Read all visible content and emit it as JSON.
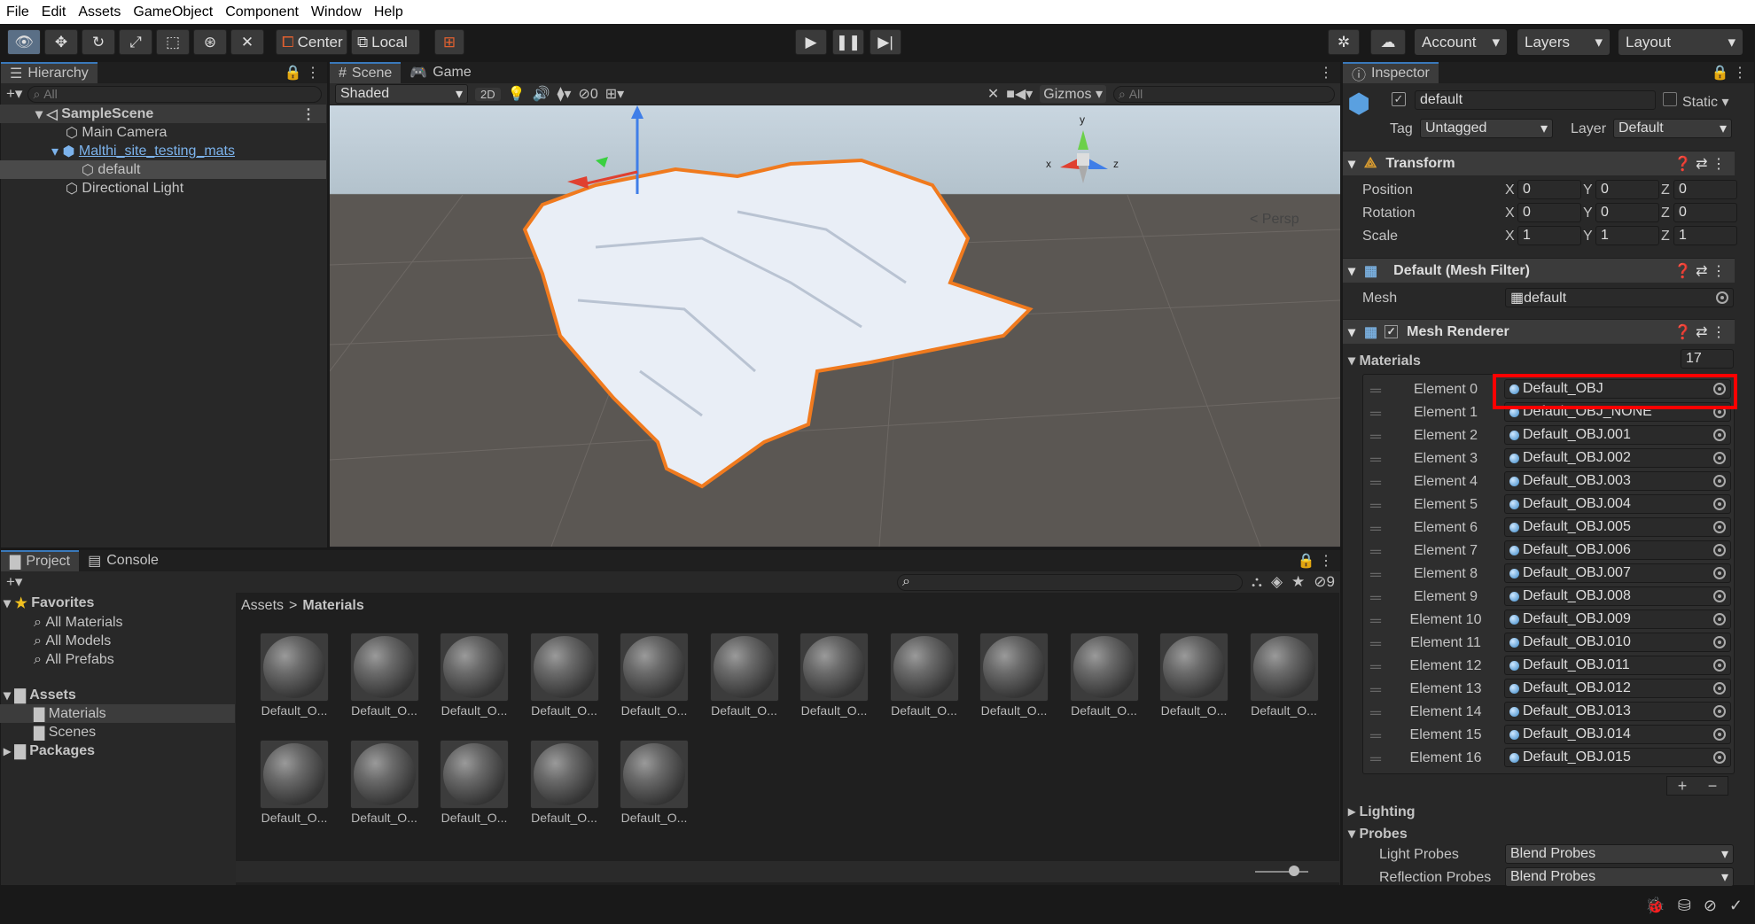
{
  "menu": [
    "File",
    "Edit",
    "Assets",
    "GameObject",
    "Component",
    "Window",
    "Help"
  ],
  "toolbar": {
    "center_label": "Center",
    "local_label": "Local",
    "account_label": "Account",
    "layers_label": "Layers",
    "layout_label": "Layout"
  },
  "hierarchy": {
    "tab": "Hierarchy",
    "search_placeholder": "All",
    "scene": "SampleScene",
    "items": [
      "Main Camera",
      "Malthi_site_testing_mats",
      "default",
      "Directional Light"
    ]
  },
  "scene": {
    "tab_scene": "Scene",
    "tab_game": "Game",
    "shading": "Shaded",
    "mode_2d": "2D",
    "hidden_count": "0",
    "gizmos": "Gizmos",
    "search_placeholder": "All",
    "persp": "< Persp",
    "axis_x": "x",
    "axis_y": "y",
    "axis_z": "z"
  },
  "project": {
    "tab_project": "Project",
    "tab_console": "Console",
    "hidden_count": "9",
    "breadcrumb_root": "Assets",
    "breadcrumb_sep": ">",
    "breadcrumb_current": "Materials",
    "favorites": "Favorites",
    "fav_items": [
      "All Materials",
      "All Models",
      "All Prefabs"
    ],
    "assets": "Assets",
    "asset_items": [
      "Materials",
      "Scenes"
    ],
    "packages": "Packages",
    "material_label": "Default_O...",
    "material_count": 17
  },
  "inspector": {
    "tab": "Inspector",
    "object_name": "default",
    "static_label": "Static",
    "tag_label": "Tag",
    "tag_value": "Untagged",
    "layer_label": "Layer",
    "layer_value": "Default",
    "transform": {
      "title": "Transform",
      "position_label": "Position",
      "rotation_label": "Rotation",
      "scale_label": "Scale",
      "position": [
        "0",
        "0",
        "0"
      ],
      "rotation": [
        "0",
        "0",
        "0"
      ],
      "scale": [
        "1",
        "1",
        "1"
      ],
      "x": "X",
      "y": "Y",
      "z": "Z"
    },
    "mesh_filter": {
      "title": "Default (Mesh Filter)",
      "mesh_label": "Mesh",
      "mesh_value": "default"
    },
    "mesh_renderer": {
      "title": "Mesh Renderer"
    },
    "materials": {
      "label": "Materials",
      "count": "17",
      "elements": [
        {
          "label": "Element 0",
          "value": "Default_OBJ"
        },
        {
          "label": "Element 1",
          "value": "Default_OBJ_NONE"
        },
        {
          "label": "Element 2",
          "value": "Default_OBJ.001"
        },
        {
          "label": "Element 3",
          "value": "Default_OBJ.002"
        },
        {
          "label": "Element 4",
          "value": "Default_OBJ.003"
        },
        {
          "label": "Element 5",
          "value": "Default_OBJ.004"
        },
        {
          "label": "Element 6",
          "value": "Default_OBJ.005"
        },
        {
          "label": "Element 7",
          "value": "Default_OBJ.006"
        },
        {
          "label": "Element 8",
          "value": "Default_OBJ.007"
        },
        {
          "label": "Element 9",
          "value": "Default_OBJ.008"
        },
        {
          "label": "Element 10",
          "value": "Default_OBJ.009"
        },
        {
          "label": "Element 11",
          "value": "Default_OBJ.010"
        },
        {
          "label": "Element 12",
          "value": "Default_OBJ.011"
        },
        {
          "label": "Element 13",
          "value": "Default_OBJ.012"
        },
        {
          "label": "Element 14",
          "value": "Default_OBJ.013"
        },
        {
          "label": "Element 15",
          "value": "Default_OBJ.014"
        },
        {
          "label": "Element 16",
          "value": "Default_OBJ.015"
        }
      ],
      "add": "+",
      "remove": "−"
    },
    "lighting": "Lighting",
    "probes": "Probes",
    "light_probes_label": "Light Probes",
    "light_probes_value": "Blend Probes",
    "reflection_probes_label": "Reflection Probes",
    "reflection_probes_value": "Blend Probes"
  },
  "colors": {
    "accent": "#3a79bb",
    "highlight_box": "#ff0000",
    "selection_outline": "#f07a1e"
  }
}
